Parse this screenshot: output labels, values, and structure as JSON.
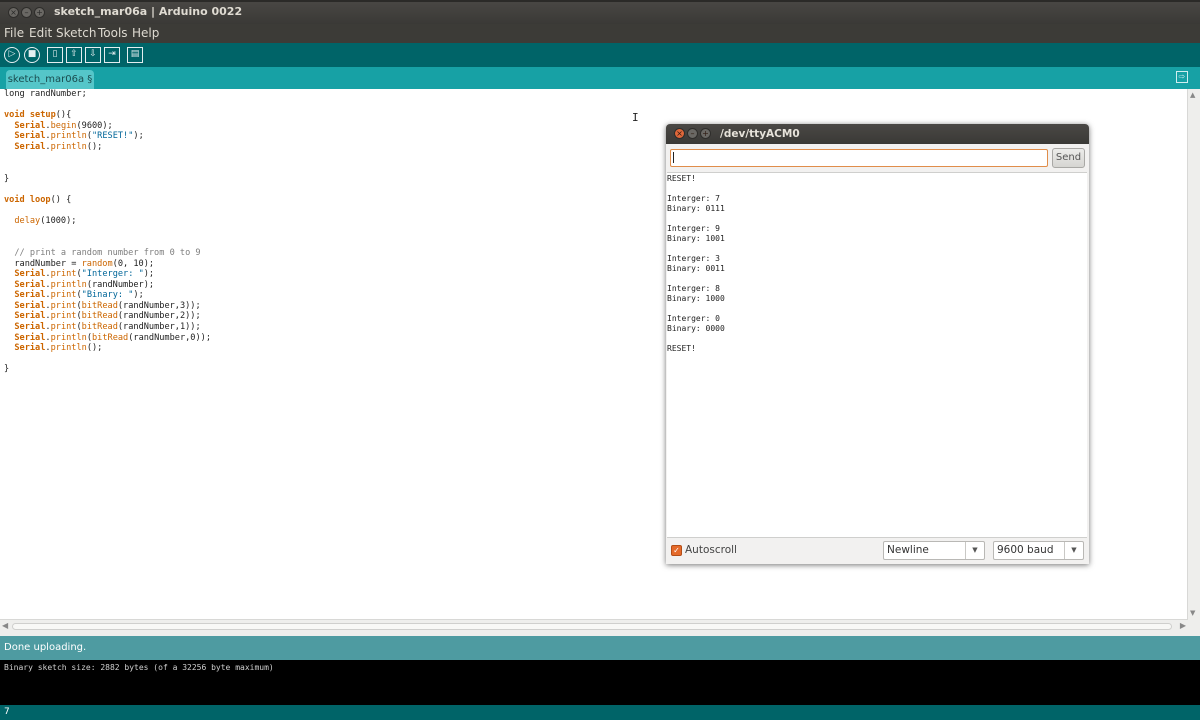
{
  "window": {
    "title": "sketch_mar06a | Arduino 0022",
    "buttons": {
      "close": "×",
      "minimize": "–",
      "maximize": "+"
    }
  },
  "menu": [
    "File",
    "Edit",
    "Sketch",
    "Tools",
    "Help"
  ],
  "toolbar": {
    "buttons": [
      {
        "name": "verify",
        "icon": "play-icon",
        "glyph": "▷"
      },
      {
        "name": "stop",
        "icon": "stop-icon",
        "glyph": "■"
      },
      {
        "name": "new",
        "icon": "new-file-icon",
        "glyph": "▯"
      },
      {
        "name": "open",
        "icon": "open-icon",
        "glyph": "⇧"
      },
      {
        "name": "save",
        "icon": "save-icon",
        "glyph": "⇩"
      },
      {
        "name": "upload",
        "icon": "upload-icon",
        "glyph": "⇥"
      },
      {
        "name": "serial-monitor",
        "icon": "serial-monitor-icon",
        "glyph": "▤"
      }
    ]
  },
  "tab": {
    "label": "sketch_mar06a §",
    "menu_glyph": "⇨"
  },
  "code_lines": [
    [
      {
        "t": "long randNumber;"
      }
    ],
    [
      {
        "t": ""
      }
    ],
    [
      {
        "t": "void ",
        "c": "kw"
      },
      {
        "t": "setup",
        "c": "kw"
      },
      {
        "t": "(){"
      }
    ],
    [
      {
        "t": "  "
      },
      {
        "t": "Serial",
        "c": "kw"
      },
      {
        "t": "."
      },
      {
        "t": "begin",
        "c": "fn"
      },
      {
        "t": "(9600);"
      }
    ],
    [
      {
        "t": "  "
      },
      {
        "t": "Serial",
        "c": "kw"
      },
      {
        "t": "."
      },
      {
        "t": "println",
        "c": "fn"
      },
      {
        "t": "("
      },
      {
        "t": "\"RESET!\"",
        "c": "str"
      },
      {
        "t": ");"
      }
    ],
    [
      {
        "t": "  "
      },
      {
        "t": "Serial",
        "c": "kw"
      },
      {
        "t": "."
      },
      {
        "t": "println",
        "c": "fn"
      },
      {
        "t": "();"
      }
    ],
    [
      {
        "t": ""
      }
    ],
    [
      {
        "t": ""
      }
    ],
    [
      {
        "t": "}"
      }
    ],
    [
      {
        "t": ""
      }
    ],
    [
      {
        "t": "void ",
        "c": "kw"
      },
      {
        "t": "loop",
        "c": "kw"
      },
      {
        "t": "() {"
      }
    ],
    [
      {
        "t": ""
      }
    ],
    [
      {
        "t": "  "
      },
      {
        "t": "delay",
        "c": "fn"
      },
      {
        "t": "(1000);"
      }
    ],
    [
      {
        "t": ""
      }
    ],
    [
      {
        "t": ""
      }
    ],
    [
      {
        "t": "  // print a random number from 0 to 9",
        "c": "cm"
      }
    ],
    [
      {
        "t": "  randNumber = "
      },
      {
        "t": "random",
        "c": "fn"
      },
      {
        "t": "(0, 10);"
      }
    ],
    [
      {
        "t": "  "
      },
      {
        "t": "Serial",
        "c": "kw"
      },
      {
        "t": "."
      },
      {
        "t": "print",
        "c": "fn"
      },
      {
        "t": "("
      },
      {
        "t": "\"Interger: \"",
        "c": "str"
      },
      {
        "t": ");"
      }
    ],
    [
      {
        "t": "  "
      },
      {
        "t": "Serial",
        "c": "kw"
      },
      {
        "t": "."
      },
      {
        "t": "println",
        "c": "fn"
      },
      {
        "t": "(randNumber);"
      }
    ],
    [
      {
        "t": "  "
      },
      {
        "t": "Serial",
        "c": "kw"
      },
      {
        "t": "."
      },
      {
        "t": "print",
        "c": "fn"
      },
      {
        "t": "("
      },
      {
        "t": "\"Binary: \"",
        "c": "str"
      },
      {
        "t": ");"
      }
    ],
    [
      {
        "t": "  "
      },
      {
        "t": "Serial",
        "c": "kw"
      },
      {
        "t": "."
      },
      {
        "t": "print",
        "c": "fn"
      },
      {
        "t": "("
      },
      {
        "t": "bitRead",
        "c": "fn"
      },
      {
        "t": "(randNumber,3));"
      }
    ],
    [
      {
        "t": "  "
      },
      {
        "t": "Serial",
        "c": "kw"
      },
      {
        "t": "."
      },
      {
        "t": "print",
        "c": "fn"
      },
      {
        "t": "("
      },
      {
        "t": "bitRead",
        "c": "fn"
      },
      {
        "t": "(randNumber,2));"
      }
    ],
    [
      {
        "t": "  "
      },
      {
        "t": "Serial",
        "c": "kw"
      },
      {
        "t": "."
      },
      {
        "t": "print",
        "c": "fn"
      },
      {
        "t": "("
      },
      {
        "t": "bitRead",
        "c": "fn"
      },
      {
        "t": "(randNumber,1));"
      }
    ],
    [
      {
        "t": "  "
      },
      {
        "t": "Serial",
        "c": "kw"
      },
      {
        "t": "."
      },
      {
        "t": "println",
        "c": "fn"
      },
      {
        "t": "("
      },
      {
        "t": "bitRead",
        "c": "fn"
      },
      {
        "t": "(randNumber,0));"
      }
    ],
    [
      {
        "t": "  "
      },
      {
        "t": "Serial",
        "c": "kw"
      },
      {
        "t": "."
      },
      {
        "t": "println",
        "c": "fn"
      },
      {
        "t": "();"
      }
    ],
    [
      {
        "t": ""
      }
    ],
    [
      {
        "t": "}"
      }
    ]
  ],
  "status": {
    "message": "Done uploading."
  },
  "console": {
    "text": "Binary sketch size: 2882 bytes (of a 32256 byte maximum)"
  },
  "line_indicator": "7",
  "serial_monitor": {
    "title": "/dev/ttyACM0",
    "input_value": "",
    "send_label": "Send",
    "output_lines": [
      "RESET!",
      "",
      "Interger: 7",
      "Binary: 0111",
      "",
      "Interger: 9",
      "Binary: 1001",
      "",
      "Interger: 3",
      "Binary: 0011",
      "",
      "Interger: 8",
      "Binary: 1000",
      "",
      "Interger: 0",
      "Binary: 0000",
      "",
      "RESET!"
    ],
    "autoscroll_label": "Autoscroll",
    "autoscroll_checked": true,
    "line_ending": "Newline",
    "baud_rate": "9600 baud",
    "checkbox_color": "#e56a2a",
    "close_button_color": "#e0673a"
  },
  "colors": {
    "toolbar": "#006468",
    "tabstrip": "#17a1a5",
    "status": "#4e9ba1"
  }
}
